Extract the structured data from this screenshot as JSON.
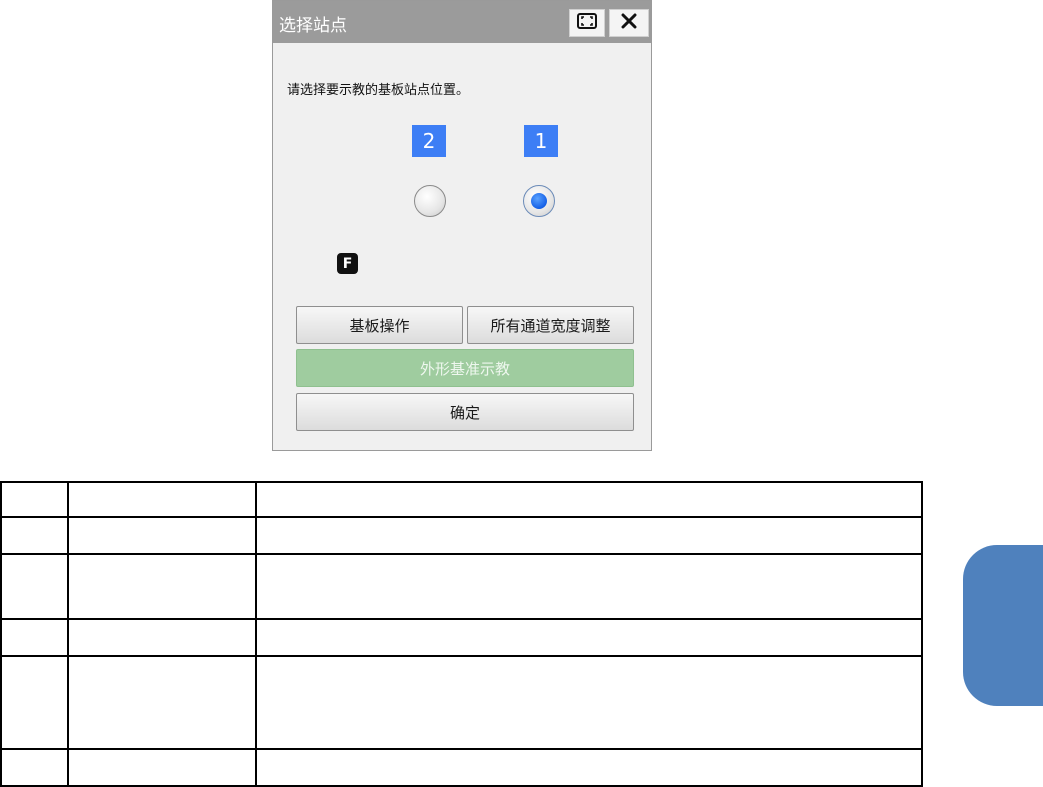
{
  "dialog": {
    "title": "选择站点",
    "prompt": "请选择要示教的基板站点位置。",
    "sites": [
      {
        "number": "2",
        "selected": false
      },
      {
        "number": "1",
        "selected": true
      }
    ],
    "f_badge": "F",
    "buttons": {
      "board_ops": "基板操作",
      "all_channel_width": "所有通道宽度调整",
      "shape_reference_teach": "外形基准示教",
      "confirm": "确定"
    },
    "icons": {
      "maximize": "maximize-icon",
      "close": "close-icon"
    }
  },
  "colors": {
    "titlebar": "#9b9b9b",
    "site_badge": "#3d7ef5",
    "teach_button": "#9fcc9f",
    "side_tab": "#4f81bd"
  }
}
